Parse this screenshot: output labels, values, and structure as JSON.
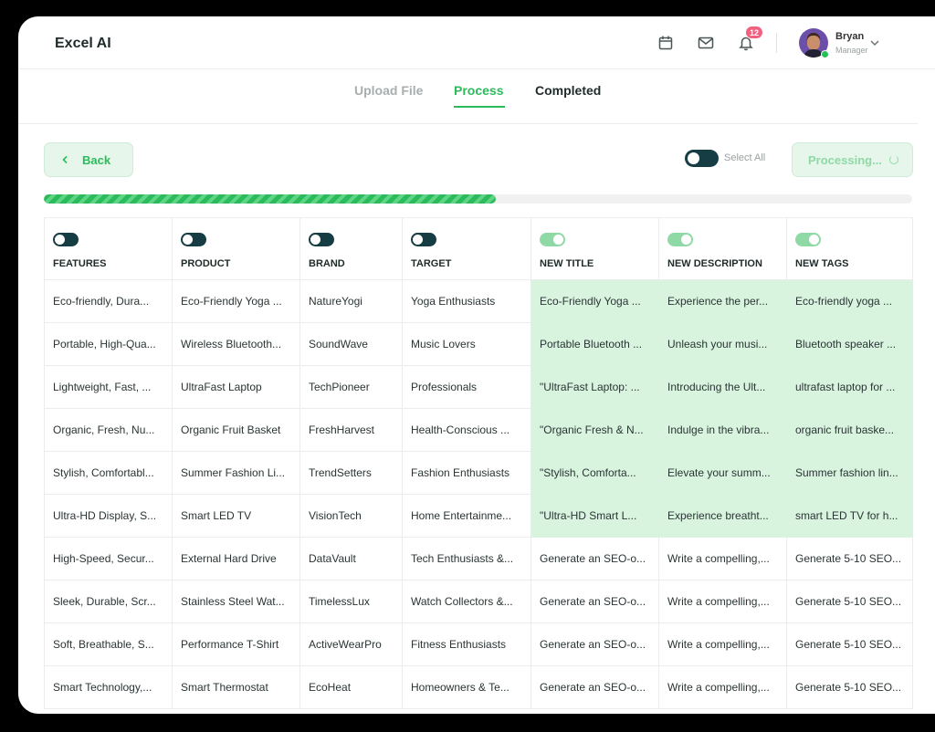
{
  "app": {
    "title": "Excel AI"
  },
  "header": {
    "notification_count": "12",
    "user": {
      "name": "Bryan",
      "role": "Manager"
    }
  },
  "tabs": [
    {
      "label": "Upload File",
      "state": "inactive"
    },
    {
      "label": "Process",
      "state": "active"
    },
    {
      "label": "Completed",
      "state": "done"
    }
  ],
  "actions": {
    "back_label": "Back",
    "select_all_label": "Select All",
    "select_all_on": true,
    "processing_label": "Processing..."
  },
  "progress": {
    "fraction": 0.52
  },
  "colors": {
    "accent": "#2cbb5b",
    "accent_light": "#d8f4df",
    "toggle_dark": "#163c44",
    "toggle_light": "#8fd9a6",
    "badge": "#f0607f"
  },
  "table": {
    "columns": [
      {
        "label": "FEATURES",
        "toggle": "dark"
      },
      {
        "label": "PRODUCT",
        "toggle": "dark"
      },
      {
        "label": "BRAND",
        "toggle": "dark"
      },
      {
        "label": "TARGET",
        "toggle": "dark"
      },
      {
        "label": "NEW TITLE",
        "toggle": "light"
      },
      {
        "label": "NEW DESCRIPTION",
        "toggle": "light"
      },
      {
        "label": "NEW TAGS",
        "toggle": "light"
      }
    ],
    "rows": [
      {
        "generated": true,
        "cells": [
          "Eco-friendly, Dura...",
          "Eco-Friendly Yoga ...",
          "NatureYogi",
          "Yoga Enthusiasts",
          "Eco-Friendly Yoga ...",
          "Experience the per...",
          "Eco-friendly yoga ..."
        ]
      },
      {
        "generated": true,
        "cells": [
          "Portable, High-Qua...",
          "Wireless Bluetooth...",
          "SoundWave",
          "Music Lovers",
          "Portable Bluetooth ...",
          "Unleash your musi...",
          "Bluetooth speaker ..."
        ]
      },
      {
        "generated": true,
        "cells": [
          "Lightweight, Fast, ...",
          "UltraFast Laptop",
          "TechPioneer",
          "Professionals",
          "\"UltraFast Laptop: ...",
          "Introducing the Ult...",
          "ultrafast laptop for ..."
        ]
      },
      {
        "generated": true,
        "cells": [
          "Organic, Fresh, Nu...",
          "Organic Fruit Basket",
          "FreshHarvest",
          "Health-Conscious ...",
          "\"Organic Fresh & N...",
          "Indulge in the vibra...",
          "organic fruit baske..."
        ]
      },
      {
        "generated": true,
        "cells": [
          "Stylish, Comfortabl...",
          "Summer Fashion Li...",
          "TrendSetters",
          "Fashion Enthusiasts",
          "\"Stylish, Comforta...",
          "Elevate your summ...",
          "Summer fashion lin..."
        ]
      },
      {
        "generated": true,
        "cells": [
          "Ultra-HD Display, S...",
          "Smart LED TV",
          "VisionTech",
          "Home Entertainme...",
          "\"Ultra-HD Smart L...",
          "Experience breatht...",
          "smart LED TV for h..."
        ]
      },
      {
        "generated": false,
        "cells": [
          "High-Speed, Secur...",
          "External Hard Drive",
          "DataVault",
          "Tech Enthusiasts &...",
          "Generate an SEO-o...",
          "Write a compelling,...",
          "Generate 5-10 SEO..."
        ]
      },
      {
        "generated": false,
        "cells": [
          "Sleek, Durable, Scr...",
          "Stainless Steel Wat...",
          "TimelessLux",
          "Watch Collectors &...",
          "Generate an SEO-o...",
          "Write a compelling,...",
          "Generate 5-10 SEO..."
        ]
      },
      {
        "generated": false,
        "cells": [
          "Soft, Breathable, S...",
          "Performance T-Shirt",
          "ActiveWearPro",
          "Fitness Enthusiasts",
          "Generate an SEO-o...",
          "Write a compelling,...",
          "Generate 5-10 SEO..."
        ]
      },
      {
        "generated": false,
        "cells": [
          "Smart Technology,...",
          "Smart Thermostat",
          "EcoHeat",
          "Homeowners & Te...",
          "Generate an SEO-o...",
          "Write a compelling,...",
          "Generate 5-10 SEO..."
        ]
      }
    ]
  }
}
